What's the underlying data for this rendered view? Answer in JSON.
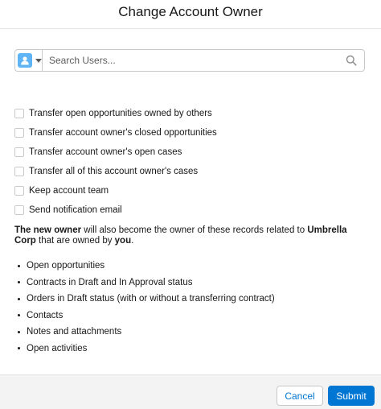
{
  "modal": {
    "title": "Change Account Owner"
  },
  "search": {
    "placeholder": "Search Users...",
    "type_icon": "user-icon",
    "icon": "search-icon"
  },
  "options": [
    {
      "label": "Transfer open opportunities owned by others",
      "checked": false
    },
    {
      "label": "Transfer account owner's closed opportunities",
      "checked": false
    },
    {
      "label": "Transfer account owner's open cases",
      "checked": false
    },
    {
      "label": "Transfer all of this account owner's cases",
      "checked": false
    },
    {
      "label": "Keep account team",
      "checked": false
    },
    {
      "label": "Send notification email",
      "checked": false
    }
  ],
  "note": {
    "bold_start": "The new owner",
    "text_1": " will also become the owner of these records related to ",
    "account": "Umbrella Corp",
    "text_2": " that are owned by ",
    "bold_end": "you",
    "text_3": "."
  },
  "records": [
    "Open opportunities",
    "Contracts in Draft and In Approval status",
    "Orders in Draft status (with or without a transferring contract)",
    "Contacts",
    "Notes and attachments",
    "Open activities"
  ],
  "footer": {
    "cancel_label": "Cancel",
    "submit_label": "Submit"
  },
  "colors": {
    "brand": "#0176d3",
    "user_icon": "#5eb4f5",
    "border": "#c9c9c9",
    "footer_bg": "#f3f3f3"
  }
}
